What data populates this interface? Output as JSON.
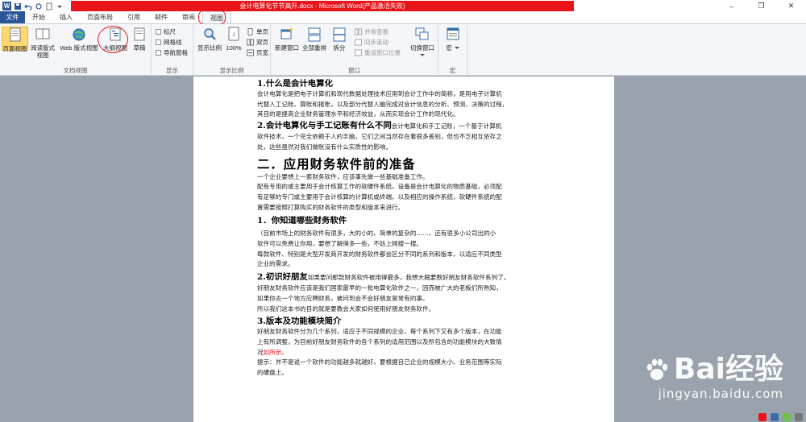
{
  "window": {
    "title": "会计电算化节节高升.docx - Microsoft Word(产品激活失败)",
    "minimize": "–",
    "restore": "❐",
    "close": "✕"
  },
  "quick_access": {
    "app_icon": "W",
    "save": "💾",
    "undo": "↶",
    "redo": "↻"
  },
  "tabs": [
    "文件",
    "开始",
    "插入",
    "页面布局",
    "引用",
    "邮件",
    "审阅",
    "视图"
  ],
  "ribbon": {
    "views_group": {
      "label": "文档视图",
      "print_layout": "页面视图",
      "full_screen_reading": "阅读版式视图",
      "web_layout": "Web 版式视图",
      "outline": "大纲视图",
      "draft": "草稿"
    },
    "show_group": {
      "label": "显示",
      "ruler": "标尺",
      "gridlines": "网格线",
      "nav_pane": "导航窗格"
    },
    "zoom_group": {
      "label": "显示比例",
      "zoom": "显示比例",
      "hundred": "100%",
      "one_page": "单页",
      "two_pages": "双页",
      "page_width": "页宽"
    },
    "window_group": {
      "label": "窗口",
      "new_window": "新建窗口",
      "arrange_all": "全部重排",
      "split": "拆分",
      "side_by_side": "并排查看",
      "sync_scroll": "同步滚动",
      "reset_position": "重设窗口位置",
      "switch_windows": "切换窗口"
    },
    "macros_group": {
      "label": "宏",
      "macros": "宏"
    }
  },
  "document": {
    "h1": "1.什么是会计电算化",
    "p1": [
      "会计电算化是把电子计算机和现代数据处理技术应用到会计工作中的简称，是用电子计算机",
      "代替人工记账、算账和报账，以及部分代替人脑完成对会计信息的分析、预测、决策的过程，",
      "其目的是提高企业财务管理水平和经济效益，从而实现会计工作的现代化。"
    ],
    "h2_inline": "2.会计电算化与手工记账有什么不同",
    "p2_first": "会计电算化和手工记账，一个基于计算机",
    "p2": [
      "软件技术，一个完全依赖于人的手脑，它们之间当然存在着很多差别，但也不乏相互依存之",
      "处，这些虽然对我们做账没有什么实质性的影响。"
    ],
    "section_title": "二．应用财务软件前的准备",
    "p3": [
      "一个企业要想上一套财务软件，应该事先做一些基础准备工作。",
      "配有专用的或主要用于会计核算工作的软硬件系统，设备是会计电算化的物质基础，必须配",
      "有足够的专门或主要用于会计核算的计算机或终端，以及相应的操作系统，软硬件系统的配",
      "置需要按照打算购买的财务软件的类型和版本来进行。"
    ],
    "h3": "1．你知道哪些财务软件",
    "p4": [
      "（目前市场上的财务软件有很多，大的小的、简单的复杂的……，还有很多小公司出的小",
      "软件可以免费让你用，要想了解得多一些，不妨上网搜一搜。",
      "每款软件、特别是大型开发商开发的财务软件都会区分不同的系列和版本，以适应不同类型",
      "企业的需求。"
    ],
    "h4_inline": "2.初识好朋友",
    "p5_first": "如果要问那款财务软件被用得最多，我想大概要数好朋友财务软件系列了，",
    "p5": [
      "好朋友财务软件应该是我们国家最早的一批电算化软件之一，因而被广大的老板们所熟知，",
      "如果你去一个地方应聘财务，被问到会不会好朋友是常有的事。",
      "所以我们这本书的目的就是要教会大家如何使用好朋友财务软件。"
    ],
    "h5": "3.版本及功能模块简介",
    "p6": [
      "好朋友财务软件分为几个系列，适应于不同规模的企业，每个系列下又有多个版本，在功能",
      "上有所调整，为目前好朋友财务软件的各个系列的适用范围以及所包含的功能模块的大致情"
    ],
    "p6_tail_prefix": "况",
    "p6_tail_red": "如所示。",
    "p7": [
      "提示：并不是说一个软件的功能越多就越好，要根据自己企业的规模大小、业务范围等实际",
      "的硬盘上。"
    ]
  },
  "watermark": {
    "brand": "Bai经验",
    "url": "jingyan.baidu.com"
  },
  "colors": {
    "accent": "#2b579a",
    "highlight_red": "#e8141a"
  }
}
